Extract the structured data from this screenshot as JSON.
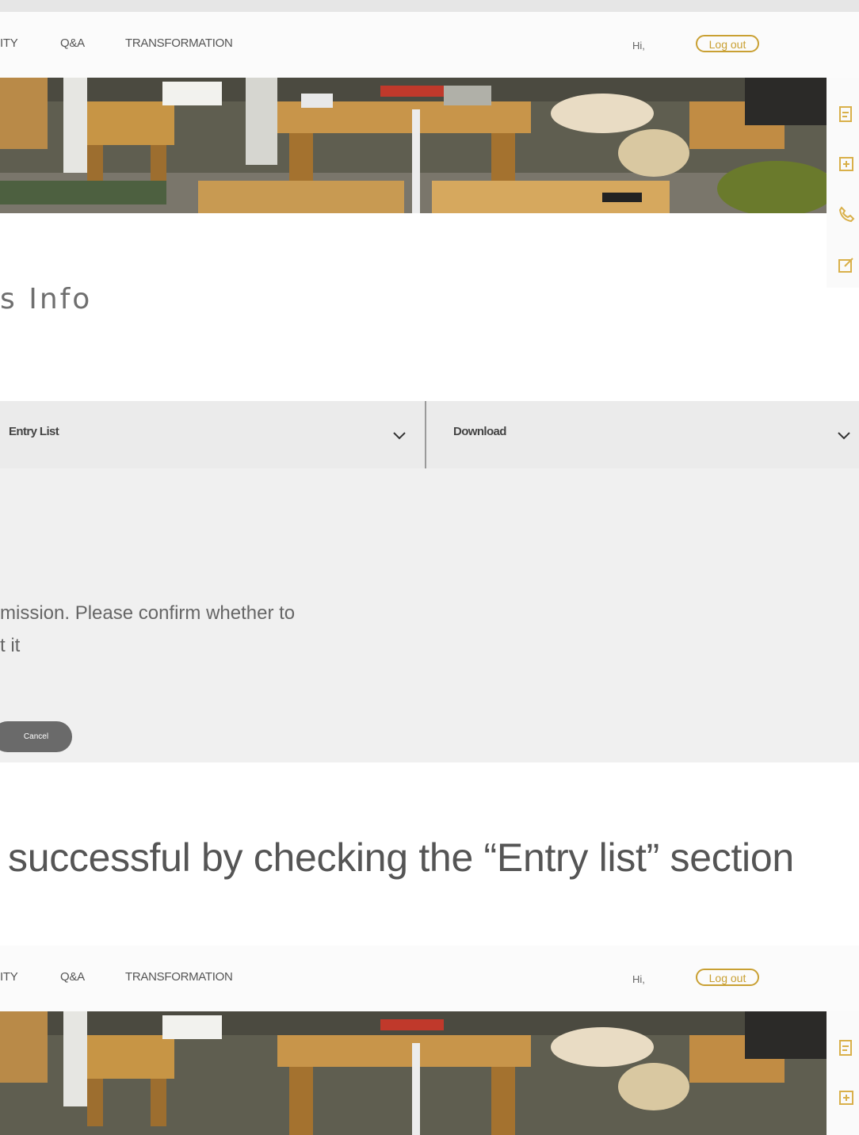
{
  "nav": {
    "items": [
      "ITY",
      "Q&A",
      "TRANSFORMATION"
    ],
    "greeting": "Hi,",
    "logout_label": "Log out"
  },
  "page": {
    "heading": "s Info",
    "entry_dropdown": "Entry List",
    "download_dropdown": "Download",
    "confirm_line1": "mission. Please confirm whether to",
    "confirm_line2": "t it",
    "cancel_label": "Cancel"
  },
  "caption": "successful by checking the “Entry list” section",
  "nav2": {
    "items": [
      "ITY",
      "Q&A",
      "TRANSFORMATION"
    ],
    "greeting": "Hi,",
    "logout_label": "Log out"
  },
  "colors": {
    "accent": "#c9a033",
    "panel": "#f0f0f0",
    "dropdown": "#ebebeb",
    "cancel": "#6a6a6a"
  },
  "icons": [
    "edit-icon",
    "chat-icon",
    "phone-icon",
    "compose-icon"
  ]
}
